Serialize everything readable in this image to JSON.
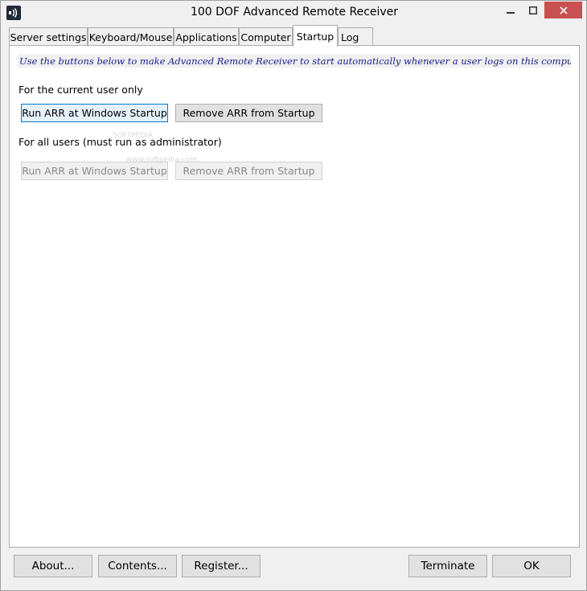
{
  "window": {
    "title": "100 DOF Advanced Remote Receiver",
    "icon": "remote-signal-icon"
  },
  "tabs": [
    {
      "label": "Server settings",
      "active": false
    },
    {
      "label": "Keyboard/Mouse",
      "active": false
    },
    {
      "label": "Applications",
      "active": false
    },
    {
      "label": "Computer",
      "active": false
    },
    {
      "label": "Startup",
      "active": true
    },
    {
      "label": "Log",
      "active": false
    }
  ],
  "startup": {
    "hint": "Use the buttons below to make Advanced Remote Receiver to start automatically whenever a user logs on this computer.",
    "current_user": {
      "label": "For the current user only",
      "run_label": "Run ARR at Windows Startup",
      "remove_label": "Remove ARR from Startup"
    },
    "all_users": {
      "label": "For all users (must run as administrator)",
      "run_label": "Run ARR at Windows Startup",
      "remove_label": "Remove ARR from Startup"
    }
  },
  "footer": {
    "about_label": "About...",
    "contents_label": "Contents...",
    "register_label": "Register...",
    "terminate_label": "Terminate",
    "ok_label": "OK"
  },
  "watermark": {
    "line1": "SOFTPEDIA",
    "line2": "www.softpedia.com"
  },
  "colors": {
    "close_button": "#c75050",
    "hint_text": "#1b1b8a",
    "focus_border": "#0078d7"
  }
}
